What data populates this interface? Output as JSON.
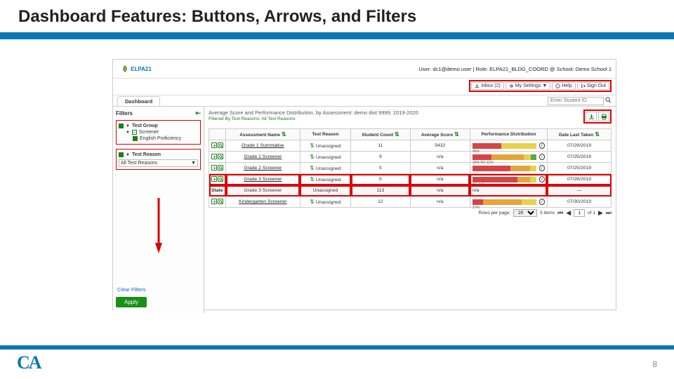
{
  "slide": {
    "title": "Dashboard Features: Buttons, Arrows, and Filters",
    "page_number": "8",
    "footer_mark": "CA"
  },
  "header": {
    "brand": "ELPA21",
    "user_line": "User: dc1@demo.user | Role: ELPA21_BLDG_COORD @ School: Demo School 1"
  },
  "toolbar": {
    "inbox": "Inbox (2)",
    "settings": "My Settings",
    "help": "Help",
    "signout": "Sign Out"
  },
  "tab": {
    "dashboard": "Dashboard"
  },
  "search": {
    "placeholder": "Enter Student ID"
  },
  "filters": {
    "title": "Filters",
    "group_label": "Test Group",
    "screener": "Screener",
    "english": "English Proficiency",
    "reason_label": "Test Reason",
    "reason_value": "All Test Reasons",
    "clear": "Clear Filters",
    "apply": "Apply"
  },
  "main": {
    "title": "Average Score and Performance Distribution, by Assessment: demo dist 9999, 2019-2020",
    "subfilter": "Filtered By  Test Reasons: All Test Reasons"
  },
  "columns": {
    "name": "Assessment Name",
    "reason": "Test Reason",
    "count": "Student Count",
    "avg": "Average Score",
    "perf": "Performance Distribution",
    "date": "Date Last Taken"
  },
  "rows": [
    {
      "name": "Grade 1 Summative",
      "reason": "Unassigned",
      "count": "11",
      "avg": "5432",
      "date": "07/29/2019",
      "perf": [
        45,
        0,
        55,
        0
      ],
      "lbl": "45%",
      "info": true
    },
    {
      "name": "Grade 1 Screener",
      "reason": "Unassigned",
      "count": "9",
      "avg": "n/a",
      "date": "07/25/2019",
      "perf": [
        30,
        50,
        11,
        9
      ],
      "lbl": "30%  9%  11%",
      "info": true
    },
    {
      "name": "Grade 2 Screener",
      "reason": "Unassigned",
      "count": "5",
      "avg": "n/a",
      "date": "07/25/2019",
      "perf": [
        60,
        30,
        10,
        0
      ],
      "lbl": "",
      "info": true
    },
    {
      "name": "Grade 3 Screener",
      "reason": "Unassigned",
      "count": "5",
      "avg": "n/a",
      "date": "07/26/2019",
      "perf": [
        70,
        20,
        10,
        0
      ],
      "lbl": "7%  67%",
      "info": true,
      "hl": true
    },
    {
      "state": true,
      "name": "Grade 3 Screener",
      "reason": "Unassigned",
      "count": "113",
      "avg": "n/a",
      "date": "—",
      "perf": [
        0,
        0,
        0,
        0
      ],
      "lbl": "n/a",
      "info": false,
      "hl": true,
      "state_label": "State"
    },
    {
      "name": "Kindergarten Screener",
      "reason": "Unassigned",
      "count": "12",
      "avg": "n/a",
      "date": "07/30/2019",
      "perf": [
        17,
        60,
        23,
        0
      ],
      "lbl": "17%",
      "info": true
    }
  ],
  "pager": {
    "rows_label": "Rows per page:",
    "pagesize": "20",
    "items": "5 items",
    "page": "1",
    "of": "of 1"
  }
}
